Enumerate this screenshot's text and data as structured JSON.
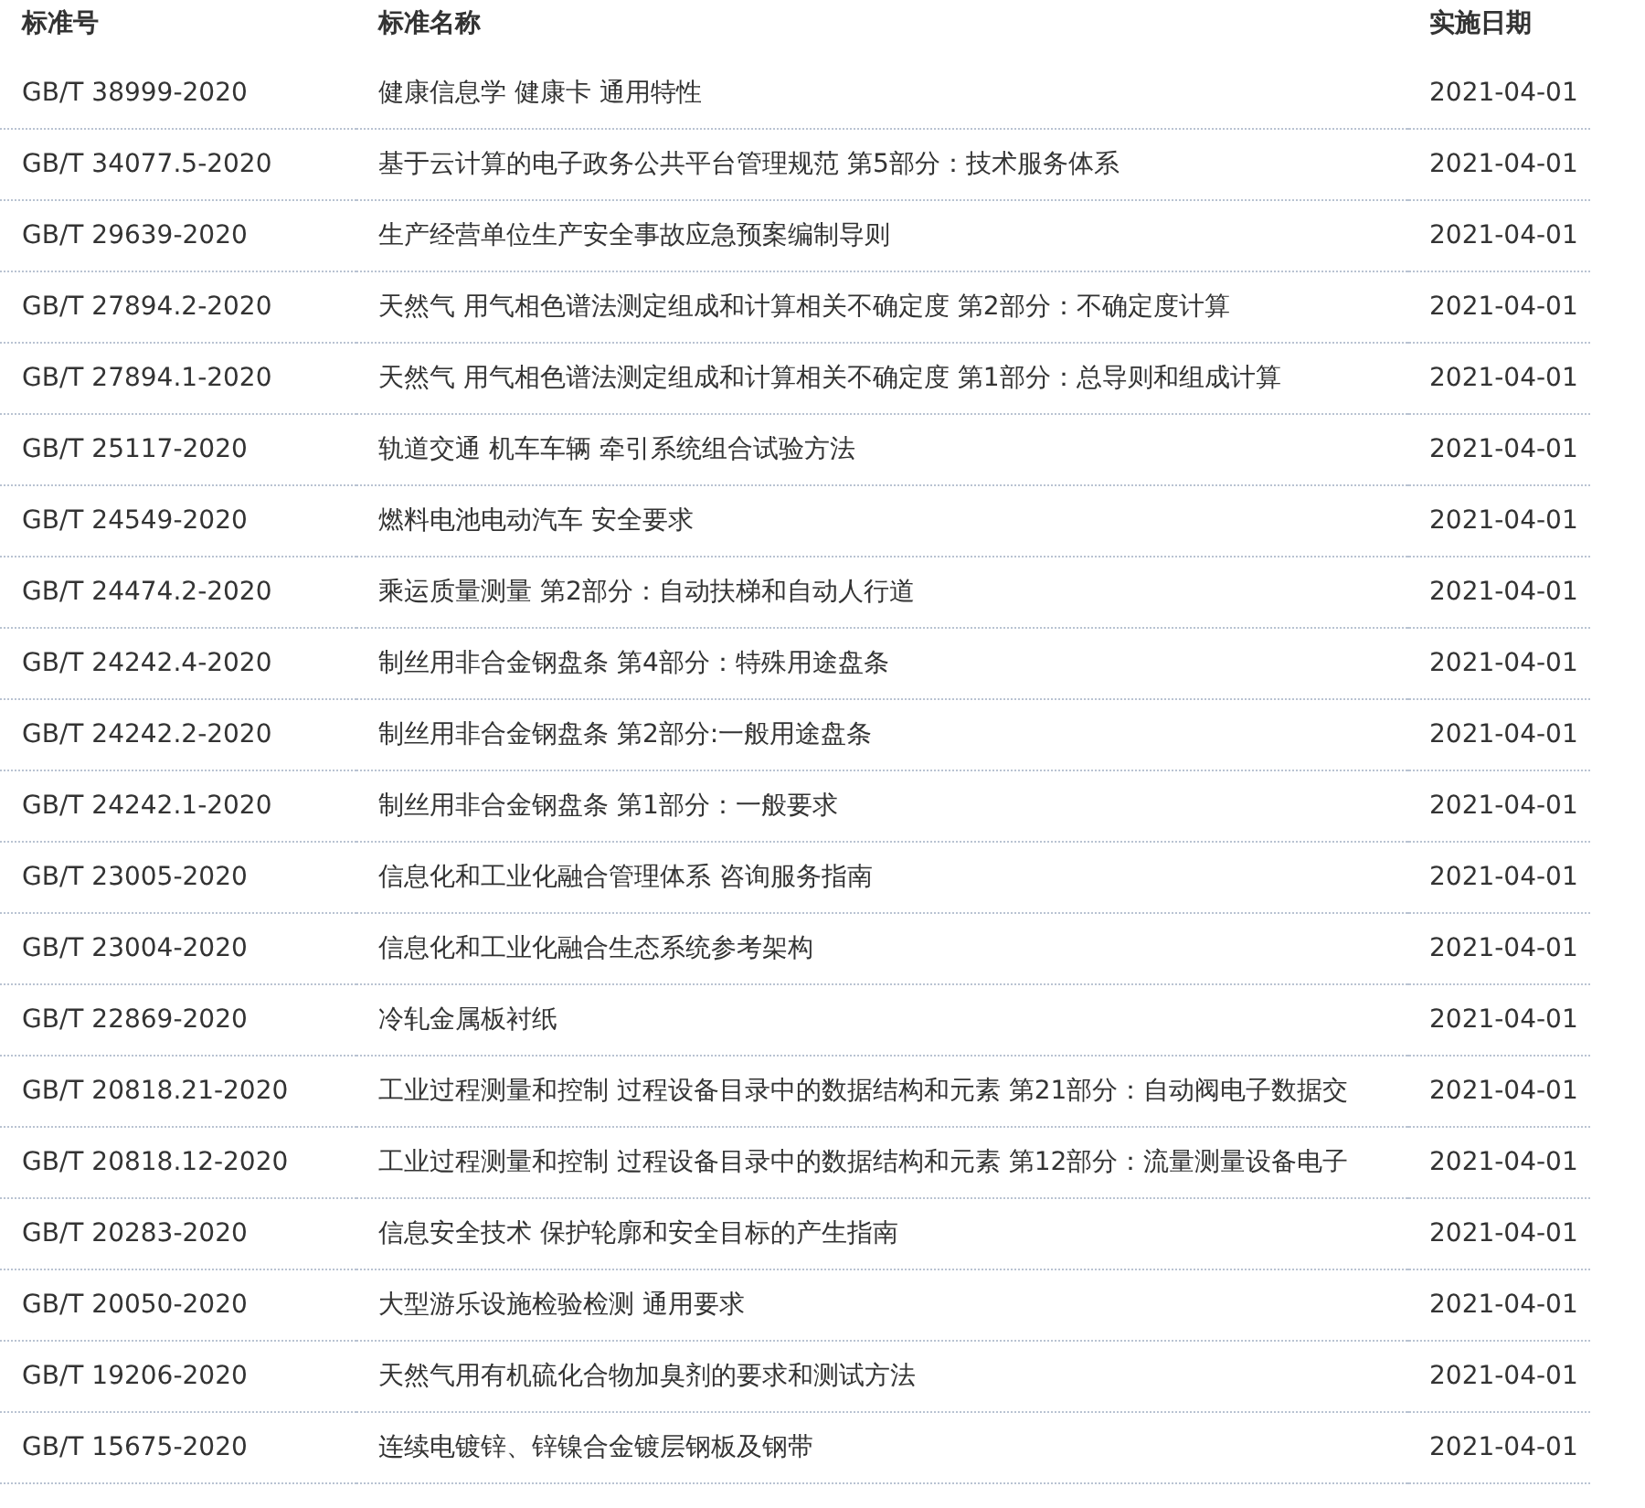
{
  "table": {
    "columns": [
      "标准号",
      "标准名称",
      "实施日期"
    ],
    "rows": [
      {
        "code": "GB/T 38999-2020",
        "name": "健康信息学 健康卡 通用特性",
        "date": "2021-04-01"
      },
      {
        "code": "GB/T 34077.5-2020",
        "name": "基于云计算的电子政务公共平台管理规范 第5部分：技术服务体系",
        "date": "2021-04-01"
      },
      {
        "code": "GB/T 29639-2020",
        "name": "生产经营单位生产安全事故应急预案编制导则",
        "date": "2021-04-01"
      },
      {
        "code": "GB/T 27894.2-2020",
        "name": "天然气 用气相色谱法测定组成和计算相关不确定度 第2部分：不确定度计算",
        "date": "2021-04-01"
      },
      {
        "code": "GB/T 27894.1-2020",
        "name": "天然气 用气相色谱法测定组成和计算相关不确定度 第1部分：总导则和组成计算",
        "date": "2021-04-01"
      },
      {
        "code": "GB/T 25117-2020",
        "name": "轨道交通 机车车辆 牵引系统组合试验方法",
        "date": "2021-04-01"
      },
      {
        "code": "GB/T 24549-2020",
        "name": "燃料电池电动汽车 安全要求",
        "date": "2021-04-01"
      },
      {
        "code": "GB/T 24474.2-2020",
        "name": "乘运质量测量 第2部分：自动扶梯和自动人行道",
        "date": "2021-04-01"
      },
      {
        "code": "GB/T 24242.4-2020",
        "name": "制丝用非合金钢盘条 第4部分：特殊用途盘条",
        "date": "2021-04-01"
      },
      {
        "code": "GB/T 24242.2-2020",
        "name": "制丝用非合金钢盘条 第2部分:一般用途盘条",
        "date": "2021-04-01"
      },
      {
        "code": "GB/T 24242.1-2020",
        "name": "制丝用非合金钢盘条 第1部分：一般要求",
        "date": "2021-04-01"
      },
      {
        "code": "GB/T 23005-2020",
        "name": "信息化和工业化融合管理体系 咨询服务指南",
        "date": "2021-04-01"
      },
      {
        "code": "GB/T 23004-2020",
        "name": "信息化和工业化融合生态系统参考架构",
        "date": "2021-04-01"
      },
      {
        "code": "GB/T 22869-2020",
        "name": "冷轧金属板衬纸",
        "date": "2021-04-01"
      },
      {
        "code": "GB/T 20818.21-2020",
        "name": "工业过程测量和控制 过程设备目录中的数据结构和元素 第21部分：自动阀电子数据交",
        "date": "2021-04-01"
      },
      {
        "code": "GB/T 20818.12-2020",
        "name": "工业过程测量和控制 过程设备目录中的数据结构和元素 第12部分：流量测量设备电子",
        "date": "2021-04-01"
      },
      {
        "code": "GB/T 20283-2020",
        "name": "信息安全技术 保护轮廓和安全目标的产生指南",
        "date": "2021-04-01"
      },
      {
        "code": "GB/T 20050-2020",
        "name": "大型游乐设施检验检测 通用要求",
        "date": "2021-04-01"
      },
      {
        "code": "GB/T 19206-2020",
        "name": "天然气用有机硫化合物加臭剂的要求和测试方法",
        "date": "2021-04-01"
      },
      {
        "code": "GB/T 15675-2020",
        "name": "连续电镀锌、锌镍合金镀层钢板及钢带",
        "date": "2021-04-01"
      }
    ]
  }
}
